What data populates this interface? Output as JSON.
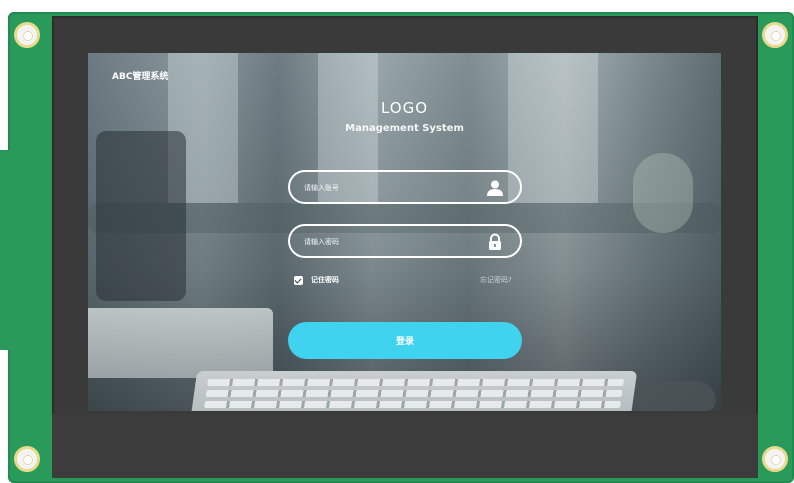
{
  "app": {
    "brand_title": "ABC管理系统",
    "logo_text": "LOGO",
    "subtitle": "Management System"
  },
  "login_form": {
    "account_placeholder": "请输入账号",
    "password_placeholder": "请输入密码",
    "remember_label": "记住密码",
    "remember_checked": true,
    "forgot_label": "忘记密码?",
    "login_button_label": "登录"
  },
  "icons": {
    "account": "user-icon",
    "password": "lock-icon",
    "remember": "checkbox-checked-icon"
  },
  "colors": {
    "accent": "#3fd3ef",
    "pcb": "#2a9a5a",
    "bezel": "#3a3a3a",
    "text": "#ffffff"
  }
}
